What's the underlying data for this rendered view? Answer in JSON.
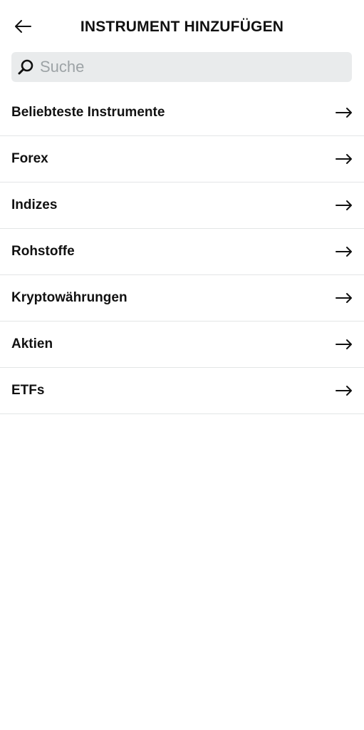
{
  "header": {
    "title": "INSTRUMENT HINZUFÜGEN",
    "back_icon": "arrow-left-icon"
  },
  "search": {
    "placeholder": "Suche",
    "value": "",
    "icon": "search-icon"
  },
  "categories": [
    {
      "label": "Beliebteste Instrumente",
      "icon": "arrow-right-icon"
    },
    {
      "label": "Forex",
      "icon": "arrow-right-icon"
    },
    {
      "label": "Indizes",
      "icon": "arrow-right-icon"
    },
    {
      "label": "Rohstoffe",
      "icon": "arrow-right-icon"
    },
    {
      "label": "Kryptowährungen",
      "icon": "arrow-right-icon"
    },
    {
      "label": "Aktien",
      "icon": "arrow-right-icon"
    },
    {
      "label": "ETFs",
      "icon": "arrow-right-icon"
    }
  ],
  "colors": {
    "background": "#ffffff",
    "search_background": "#e9ebec",
    "text": "#111111",
    "placeholder": "#9da3a6",
    "divider": "#e3e5e6"
  }
}
